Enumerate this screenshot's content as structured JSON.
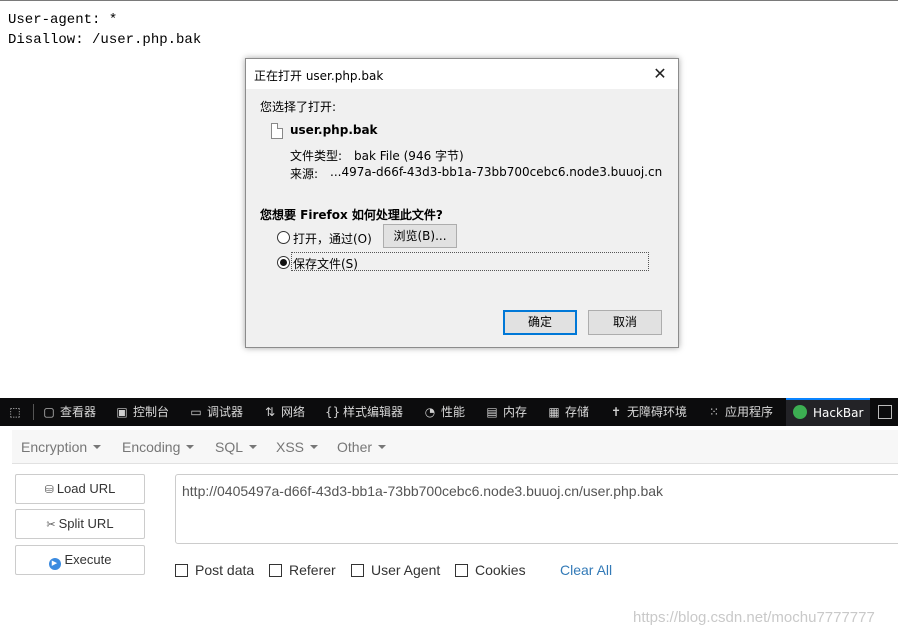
{
  "robots": {
    "line1": "User-agent: *",
    "line2": "Disallow: /user.php.bak"
  },
  "dialog": {
    "title": "正在打开 user.php.bak",
    "intro": "您选择了打开:",
    "filename": "user.php.bak",
    "type_label": "文件类型:",
    "type_value": "bak File (946 字节)",
    "source_label": "来源:",
    "source_value": "...497a-d66f-43d3-bb1a-73bb700cebc6.node3.buuoj.cn",
    "question": "您想要 Firefox 如何处理此文件?",
    "open_with_label": "打开，通过(O)",
    "browse_label": "浏览(B)...",
    "save_label": "保存文件(S)",
    "ok_label": "确定",
    "cancel_label": "取消",
    "close_glyph": "✕"
  },
  "devtools": {
    "tabs": [
      {
        "label": "查看器",
        "icon": "inspector-icon"
      },
      {
        "label": "控制台",
        "icon": "console-icon"
      },
      {
        "label": "调试器",
        "icon": "debugger-icon"
      },
      {
        "label": "网络",
        "icon": "network-icon"
      },
      {
        "label": "样式编辑器",
        "icon": "style-editor-icon"
      },
      {
        "label": "性能",
        "icon": "performance-icon"
      },
      {
        "label": "内存",
        "icon": "memory-icon"
      },
      {
        "label": "存储",
        "icon": "storage-icon"
      },
      {
        "label": "无障碍环境",
        "icon": "accessibility-icon"
      },
      {
        "label": "应用程序",
        "icon": "application-icon"
      },
      {
        "label": "HackBar",
        "icon": "hackbar-icon"
      }
    ],
    "active_tab": "HackBar"
  },
  "hackbar": {
    "menus": [
      "Encryption",
      "Encoding",
      "SQL",
      "XSS",
      "Other"
    ],
    "load_url": "Load URL",
    "split_url": "Split URL",
    "execute": "Execute",
    "url_value": "http://0405497a-d66f-43d3-bb1a-73bb700cebc6.node3.buuoj.cn/user.php.bak",
    "options": [
      "Post data",
      "Referer",
      "User Agent",
      "Cookies"
    ],
    "clear_all": "Clear All"
  },
  "watermark": "https://blog.csdn.net/mochu7777777"
}
